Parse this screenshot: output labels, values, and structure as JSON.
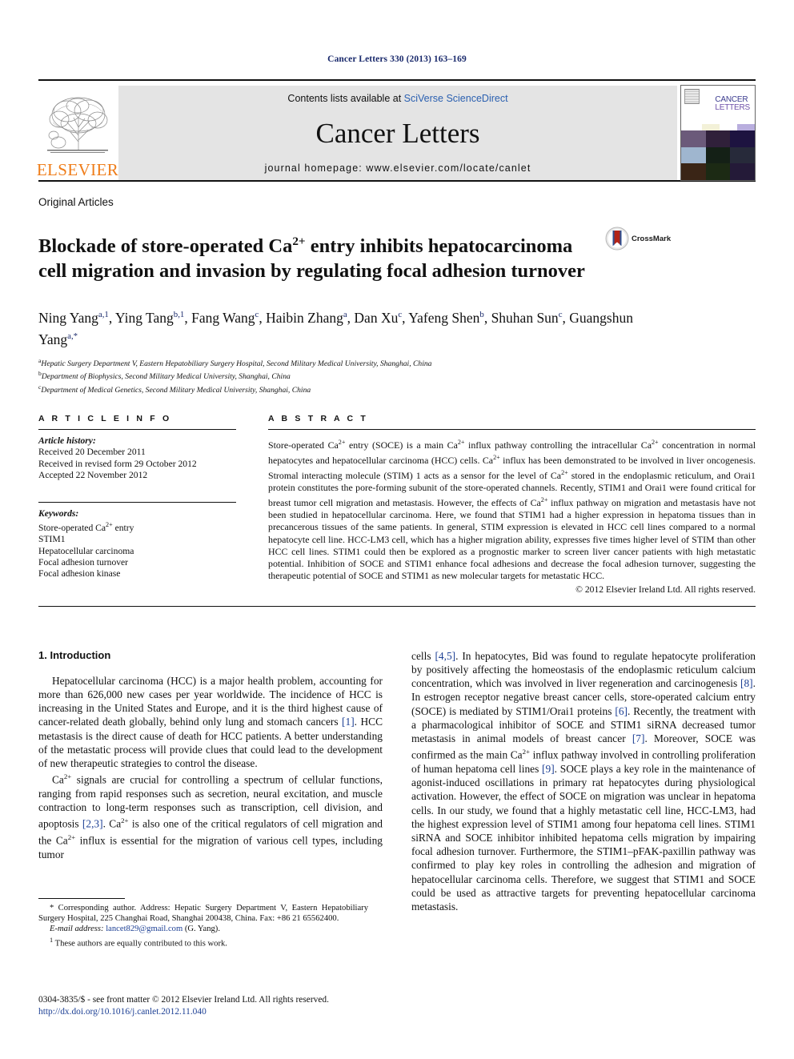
{
  "running_head": "Cancer Letters 330 (2013) 163–169",
  "banner": {
    "publisher_name": "ELSEVIER",
    "contents_prefix": "Contents lists available at ",
    "contents_link": "SciVerse ScienceDirect",
    "journal_name": "Cancer Letters",
    "homepage": "journal homepage: www.elsevier.com/locate/canlet",
    "cover_title_line1": "CANCER",
    "cover_title_line2": "LETTERS"
  },
  "article": {
    "type": "Original Articles",
    "title_line1": "Blockade of store-operated Ca",
    "title_sup1": "2+",
    "title_line1b": " entry inhibits hepatocarcinoma cell",
    "title_line2": "migration and invasion by regulating focal adhesion turnover",
    "crossmark_label": "CrossMark",
    "authors": "Ning Yang a,1, Ying Tang b,1, Fang Wang c, Haibin Zhang a, Dan Xu c, Yafeng Shen b, Shuhan Sun c, Guangshun Yang a,*",
    "affiliations": [
      "Hepatic Surgery Department V, Eastern Hepatobiliary Surgery Hospital, Second Military Medical University, Shanghai, China",
      "Department of Biophysics, Second Military Medical University, Shanghai, China",
      "Department of Medical Genetics, Second Military Medical University, Shanghai, China"
    ],
    "affiliation_marks": [
      "a",
      "b",
      "c"
    ]
  },
  "info": {
    "heading": "A R T I C L E  I N F O",
    "history_label": "Article history:",
    "history": [
      "Received 20 December 2011",
      "Received in revised form 29 October 2012",
      "Accepted 22 November 2012"
    ],
    "keywords_label": "Keywords:",
    "keywords": [
      "Store-operated Ca2+ entry",
      "STIM1",
      "Hepatocellular carcinoma",
      "Focal adhesion turnover",
      "Focal adhesion kinase"
    ]
  },
  "abstract": {
    "heading": "A B S T R A C T",
    "text": "Store-operated Ca2+ entry (SOCE) is a main Ca2+ influx pathway controlling the intracellular Ca2+ concentration in normal hepatocytes and hepatocellular carcinoma (HCC) cells. Ca2+ influx has been demonstrated to be involved in liver oncogenesis. Stromal interacting molecule (STIM) 1 acts as a sensor for the level of Ca2+ stored in the endoplasmic reticulum, and Orai1 protein constitutes the pore-forming subunit of the store-operated channels. Recently, STIM1 and Orai1 were found critical for breast tumor cell migration and metastasis. However, the effects of Ca2+ influx pathway on migration and metastasis have not been studied in hepatocellular carcinoma. Here, we found that STIM1 had a higher expression in hepatoma tissues than in precancerous tissues of the same patients. In general, STIM expression is elevated in HCC cell lines compared to a normal hepatocyte cell line. HCC-LM3 cell, which has a higher migration ability, expresses five times higher level of STIM than other HCC cell lines. STIM1 could then be explored as a prognostic marker to screen liver cancer patients with high metastatic potential. Inhibition of SOCE and STIM1 enhance focal adhesions and decrease the focal adhesion turnover, suggesting the therapeutic potential of SOCE and STIM1 as new molecular targets for metastatic HCC.",
    "copyright": "© 2012 Elsevier Ireland Ltd. All rights reserved."
  },
  "introduction": {
    "heading": "1. Introduction",
    "left_paragraph_1": "Hepatocellular carcinoma (HCC) is a major health problem, accounting for more than 626,000 new cases per year worldwide. The incidence of HCC is increasing in the United States and Europe, and it is the third highest cause of cancer-related death globally, behind only lung and stomach cancers [1]. HCC metastasis is the direct cause of death for HCC patients. A better understanding of the metastatic process will provide clues that could lead to the development of new therapeutic strategies to control the disease.",
    "left_paragraph_2": "Ca2+ signals are crucial for controlling a spectrum of cellular functions, ranging from rapid responses such as secretion, neural excitation, and muscle contraction to long-term responses such as transcription, cell division, and apoptosis [2,3]. Ca2+ is also one of the critical regulators of cell migration and the Ca2+ influx is essential for the migration of various cell types, including tumor",
    "right_paragraph_1": "cells [4,5]. In hepatocytes, Bid was found to regulate hepatocyte proliferation by positively affecting the homeostasis of the endoplasmic reticulum calcium concentration, which was involved in liver regeneration and carcinogenesis [8]. In estrogen receptor negative breast cancer cells, store-operated calcium entry (SOCE) is mediated by STIM1/Orai1 proteins [6]. Recently, the treatment with a pharmacological inhibitor of SOCE and STIM1 siRNA decreased tumor metastasis in animal models of breast cancer [7]. Moreover, SOCE was confirmed as the main Ca2+ influx pathway involved in controlling proliferation of human hepatoma cell lines [9]. SOCE plays a key role in the maintenance of agonist-induced oscillations in primary rat hepatocytes during physiological activation. However, the effect of SOCE on migration was unclear in hepatoma cells. In our study, we found that a highly metastatic cell line, HCC-LM3, had the highest expression level of STIM1 among four hepatoma cell lines. STIM1 siRNA and SOCE inhibitor inhibited hepatoma cells migration by impairing focal adhesion turnover. Furthermore, the STIM1–pFAK-paxillin pathway was confirmed to play key roles in controlling the adhesion and migration of hepatocellular carcinoma cells. Therefore, we suggest that STIM1 and SOCE could be used as attractive targets for preventing hepatocellular carcinoma metastasis."
  },
  "footnotes": {
    "corresponding": "* Corresponding author. Address: Hepatic Surgery Department V, Eastern Hepatobiliary Surgery Hospital, 225 Changhai Road, Shanghai 200438, China. Fax: +86 21 65562400.",
    "email_label": "E-mail address:",
    "email": "lancet829@gmail.com",
    "email_author": " (G. Yang).",
    "equal_contrib_marker": "1",
    "equal_contrib": "These authors are equally contributed to this work."
  },
  "issn": {
    "line1": "0304-3835/$ - see front matter © 2012 Elsevier Ireland Ltd. All rights reserved.",
    "doi": "http://dx.doi.org/10.1016/j.canlet.2012.11.040"
  },
  "colors": {
    "running_head": "#1a2a6c",
    "link": "#2b60b0",
    "reference": "#1c3f94",
    "elsevier_orange": "#ef7d1a",
    "banner_bg": "#e4e4e4"
  }
}
